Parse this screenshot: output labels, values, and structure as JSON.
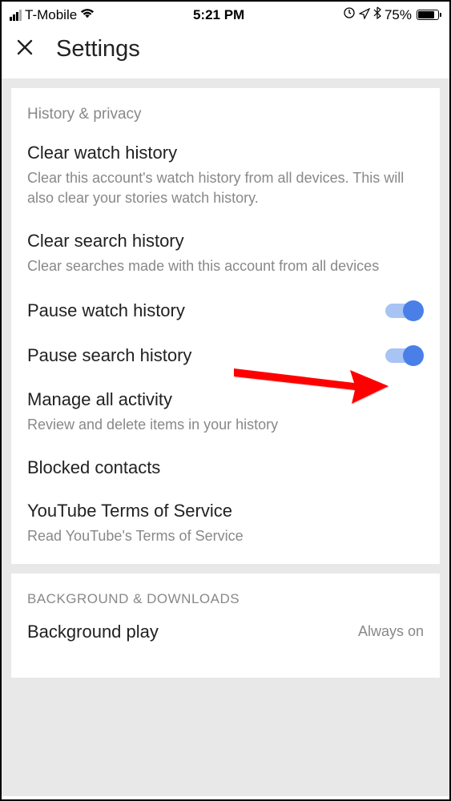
{
  "statusBar": {
    "carrier": "T-Mobile",
    "time": "5:21 PM",
    "batteryPercent": "75%"
  },
  "header": {
    "title": "Settings"
  },
  "sections": [
    {
      "header": "History & privacy",
      "items": [
        {
          "title": "Clear watch history",
          "desc": "Clear this account's watch history from all devices. This will also clear your stories watch history."
        },
        {
          "title": "Clear search history",
          "desc": "Clear searches made with this account from all devices"
        },
        {
          "title": "Pause watch history",
          "toggle": true
        },
        {
          "title": "Pause search history",
          "toggle": true
        },
        {
          "title": "Manage all activity",
          "desc": "Review and delete items in your history"
        },
        {
          "title": "Blocked contacts"
        },
        {
          "title": "YouTube Terms of Service",
          "desc": "Read YouTube's Terms of Service"
        }
      ]
    },
    {
      "header": "BACKGROUND & DOWNLOADS",
      "items": [
        {
          "title": "Background play",
          "value": "Always on"
        }
      ]
    }
  ]
}
